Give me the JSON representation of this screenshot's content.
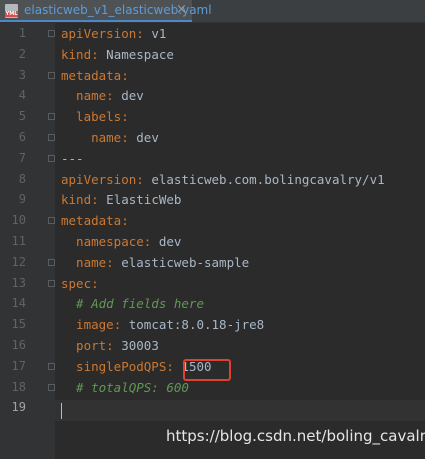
{
  "tab": {
    "icon_name": "yaml-file-icon",
    "icon_badge": "YML",
    "title": "elasticweb_v1_elasticweb.yaml",
    "close_glyph": "×"
  },
  "lines": [
    {
      "num": "1",
      "parts": [
        {
          "t": "apiVersion",
          "c": "key"
        },
        {
          "t": ": ",
          "c": "punct"
        },
        {
          "t": "v1",
          "c": "val"
        }
      ]
    },
    {
      "num": "2",
      "parts": [
        {
          "t": "kind",
          "c": "key"
        },
        {
          "t": ": ",
          "c": "punct"
        },
        {
          "t": "Namespace",
          "c": "val"
        }
      ]
    },
    {
      "num": "3",
      "parts": [
        {
          "t": "metadata",
          "c": "key"
        },
        {
          "t": ":",
          "c": "punct"
        }
      ]
    },
    {
      "num": "4",
      "parts": [
        {
          "t": "  name",
          "c": "key"
        },
        {
          "t": ": ",
          "c": "punct"
        },
        {
          "t": "dev",
          "c": "val"
        }
      ]
    },
    {
      "num": "5",
      "parts": [
        {
          "t": "  labels",
          "c": "key"
        },
        {
          "t": ":",
          "c": "punct"
        }
      ]
    },
    {
      "num": "6",
      "parts": [
        {
          "t": "    name",
          "c": "key"
        },
        {
          "t": ": ",
          "c": "punct"
        },
        {
          "t": "dev",
          "c": "val"
        }
      ]
    },
    {
      "num": "7",
      "parts": [
        {
          "t": "---",
          "c": "sep"
        }
      ]
    },
    {
      "num": "8",
      "parts": [
        {
          "t": "apiVersion",
          "c": "key"
        },
        {
          "t": ": ",
          "c": "punct"
        },
        {
          "t": "elasticweb.com.bolingcavalry/v1",
          "c": "val"
        }
      ]
    },
    {
      "num": "9",
      "parts": [
        {
          "t": "kind",
          "c": "key"
        },
        {
          "t": ": ",
          "c": "punct"
        },
        {
          "t": "ElasticWeb",
          "c": "val"
        }
      ]
    },
    {
      "num": "10",
      "parts": [
        {
          "t": "metadata",
          "c": "key"
        },
        {
          "t": ":",
          "c": "punct"
        }
      ]
    },
    {
      "num": "11",
      "parts": [
        {
          "t": "  namespace",
          "c": "key"
        },
        {
          "t": ": ",
          "c": "punct"
        },
        {
          "t": "dev",
          "c": "val"
        }
      ]
    },
    {
      "num": "12",
      "parts": [
        {
          "t": "  name",
          "c": "key"
        },
        {
          "t": ": ",
          "c": "punct"
        },
        {
          "t": "elasticweb-sample",
          "c": "val"
        }
      ]
    },
    {
      "num": "13",
      "parts": [
        {
          "t": "spec",
          "c": "key"
        },
        {
          "t": ":",
          "c": "punct"
        }
      ]
    },
    {
      "num": "14",
      "parts": [
        {
          "t": "  # Add fields here",
          "c": "comment"
        }
      ]
    },
    {
      "num": "15",
      "parts": [
        {
          "t": "  image",
          "c": "key"
        },
        {
          "t": ": ",
          "c": "punct"
        },
        {
          "t": "tomcat:8.0.18-jre8",
          "c": "val"
        }
      ]
    },
    {
      "num": "16",
      "parts": [
        {
          "t": "  port",
          "c": "key"
        },
        {
          "t": ": ",
          "c": "punct"
        },
        {
          "t": "30003",
          "c": "val"
        }
      ]
    },
    {
      "num": "17",
      "parts": [
        {
          "t": "  singlePodQPS",
          "c": "key"
        },
        {
          "t": ": ",
          "c": "punct"
        },
        {
          "t": "1500",
          "c": "val"
        }
      ]
    },
    {
      "num": "18",
      "parts": [
        {
          "t": "  # totalQPS: 600",
          "c": "comment"
        }
      ]
    },
    {
      "num": "19",
      "parts": []
    }
  ],
  "highlighted_value": "1500",
  "current_line": "19",
  "watermark": "https://blog.csdn.net/boling_cavalry",
  "colors": {
    "background": "#2b2b2b",
    "key": "#cc7832",
    "value": "#a9b7c6",
    "comment": "#629755",
    "highlight_box": "#e0412f",
    "tab_text": "#5d9cd8"
  }
}
